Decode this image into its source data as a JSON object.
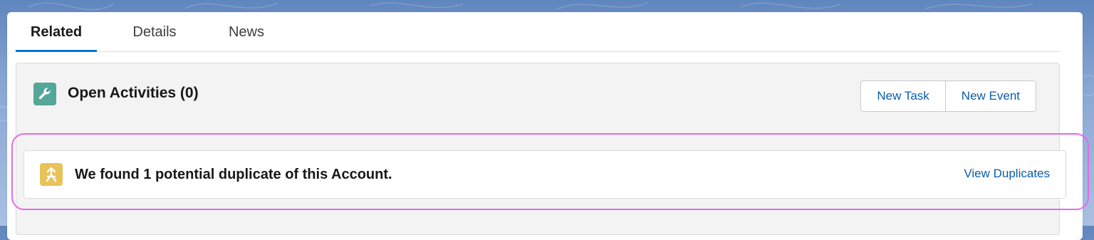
{
  "tabs": [
    {
      "label": "Related",
      "active": true
    },
    {
      "label": "Details",
      "active": false
    },
    {
      "label": "News",
      "active": false
    }
  ],
  "activities": {
    "title": "Open Activities (0)",
    "icon": "wrench-icon",
    "icon_color": "#54a698",
    "buttons": {
      "new_task": "New Task",
      "new_event": "New Event"
    }
  },
  "duplicate_alert": {
    "message": "We found 1 potential duplicate of this Account.",
    "link": "View Duplicates",
    "icon": "merge-icon",
    "icon_color": "#e8c35a"
  },
  "colors": {
    "accent": "#0176d3",
    "link": "#0b5cab",
    "highlight": "#e66ae6"
  }
}
